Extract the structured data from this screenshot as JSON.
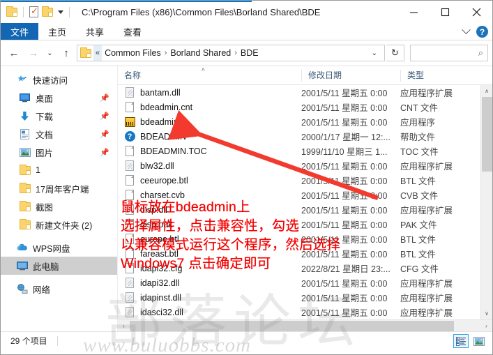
{
  "window": {
    "title_path": "C:\\Program Files (x86)\\Common Files\\Borland Shared\\BDE",
    "minimize": "─",
    "maximize": "☐",
    "close": "✕"
  },
  "quick_access": {
    "folder_icon": "folder-icon",
    "properties_icon": "properties-icon",
    "new_folder_icon": "new-folder-icon",
    "dropdown_icon": "chevron-down-icon"
  },
  "ribbon": {
    "tabs": [
      {
        "label": "文件",
        "active": true
      },
      {
        "label": "主页",
        "active": false
      },
      {
        "label": "共享",
        "active": false
      },
      {
        "label": "查看",
        "active": false
      }
    ],
    "collapse_icon": "chevron-down-icon",
    "help_label": "?"
  },
  "address_bar": {
    "back_icon": "←",
    "forward_icon": "→",
    "recent_icon": "⌄",
    "up_icon": "↑",
    "folder_icon": "folder-icon",
    "overflow": "«",
    "crumbs": [
      "Common Files",
      "Borland Shared",
      "BDE"
    ],
    "separator": "›",
    "dropdown_icon": "⌄",
    "refresh_icon": "↻"
  },
  "search": {
    "value": "",
    "placeholder": "",
    "icon": "search-icon"
  },
  "sidebar": {
    "groups": [
      {
        "name": "快速访问",
        "icon": "star-pin-icon",
        "items": [
          {
            "label": "桌面",
            "icon": "desktop-icon",
            "pinned": true
          },
          {
            "label": "下载",
            "icon": "download-icon",
            "pinned": true
          },
          {
            "label": "文档",
            "icon": "documents-icon",
            "pinned": true
          },
          {
            "label": "图片",
            "icon": "pictures-icon",
            "pinned": true
          },
          {
            "label": "1",
            "icon": "folder-icon",
            "pinned": false
          },
          {
            "label": "17周年客户端",
            "icon": "folder-icon",
            "pinned": false
          },
          {
            "label": "截图",
            "icon": "folder-icon",
            "pinned": false
          },
          {
            "label": "新建文件夹 (2)",
            "icon": "folder-icon",
            "pinned": false
          }
        ]
      }
    ],
    "roots": [
      {
        "label": "WPS网盘",
        "icon": "cloud-icon",
        "selected": false
      },
      {
        "label": "此电脑",
        "icon": "this-pc-icon",
        "selected": true
      },
      {
        "label": "网络",
        "icon": "network-icon",
        "selected": false
      }
    ]
  },
  "file_list": {
    "columns": [
      {
        "key": "name",
        "label": "名称",
        "sorted": true,
        "sort_dir": "asc"
      },
      {
        "key": "date",
        "label": "修改日期"
      },
      {
        "key": "type",
        "label": "类型"
      }
    ],
    "rows": [
      {
        "name": "bantam.dll",
        "date": "2001/5/11 星期五 0:00",
        "type": "应用程序扩展",
        "icon": "dll-icon"
      },
      {
        "name": "bdeadmin.cnt",
        "date": "2001/5/11 星期五 0:00",
        "type": "CNT 文件",
        "icon": "doc-icon"
      },
      {
        "name": "bdeadmin",
        "date": "2001/5/11 星期五 0:00",
        "type": "应用程序",
        "icon": "exe-icon"
      },
      {
        "name": "BDEADMIN",
        "date": "2000/1/17 星期一 12:...",
        "type": "帮助文件",
        "icon": "help-icon"
      },
      {
        "name": "BDEADMIN.TOC",
        "date": "1999/11/10 星期三 1...",
        "type": "TOC 文件",
        "icon": "doc-icon"
      },
      {
        "name": "blw32.dll",
        "date": "2001/5/11 星期五 0:00",
        "type": "应用程序扩展",
        "icon": "dll-icon"
      },
      {
        "name": "ceeurope.btl",
        "date": "2001/5/11 星期五 0:00",
        "type": "BTL 文件",
        "icon": "doc-icon"
      },
      {
        "name": "charset.cvb",
        "date": "2001/5/11 星期五 0:00",
        "type": "CVB 文件",
        "icon": "doc-icon"
      },
      {
        "name": "disp.dll",
        "date": "2001/5/11 星期五 0:00",
        "type": "应用程序扩展",
        "icon": "dll-icon"
      },
      {
        "name": "disp.pak",
        "date": "2001/5/11 星期五 0:00",
        "type": "PAK 文件",
        "icon": "doc-icon"
      },
      {
        "name": "europe.btl",
        "date": "2001/5/11 星期五 0:00",
        "type": "BTL 文件",
        "icon": "doc-icon"
      },
      {
        "name": "fareast.btl",
        "date": "2001/5/11 星期五 0:00",
        "type": "BTL 文件",
        "icon": "doc-icon"
      },
      {
        "name": "idapi32.cfg",
        "date": "2022/8/21 星期日 23:...",
        "type": "CFG 文件",
        "icon": "doc-icon"
      },
      {
        "name": "idapi32.dll",
        "date": "2001/5/11 星期五 0:00",
        "type": "应用程序扩展",
        "icon": "dll-icon"
      },
      {
        "name": "idapinst.dll",
        "date": "2001/5/11 星期五 0:00",
        "type": "应用程序扩展",
        "icon": "dll-icon"
      },
      {
        "name": "idasci32.dll",
        "date": "2001/5/11 星期五 0:00",
        "type": "应用程序扩展",
        "icon": "dll-icon"
      }
    ],
    "scroll_up_icon": "∧",
    "scroll_down_icon": "∨",
    "scroll_left_icon": "‹",
    "scroll_right_icon": "›"
  },
  "status_bar": {
    "item_count": "29 个项目",
    "details_view_icon": "details-view-icon",
    "large_icons_view_icon": "large-icons-view-icon"
  },
  "annotation": {
    "color": "#f40000",
    "lines": [
      "鼠标放在bdeadmin上",
      "选择属性，点击兼容性，勾选",
      "以兼容模式运行这个程序，然后选择",
      "Windows7 点击确定即可"
    ],
    "arrow": "red-arrow-pointing-to-bdeadmin"
  },
  "watermark": {
    "big_text": "部落论坛",
    "url_text": "www.buluobbs.com"
  }
}
